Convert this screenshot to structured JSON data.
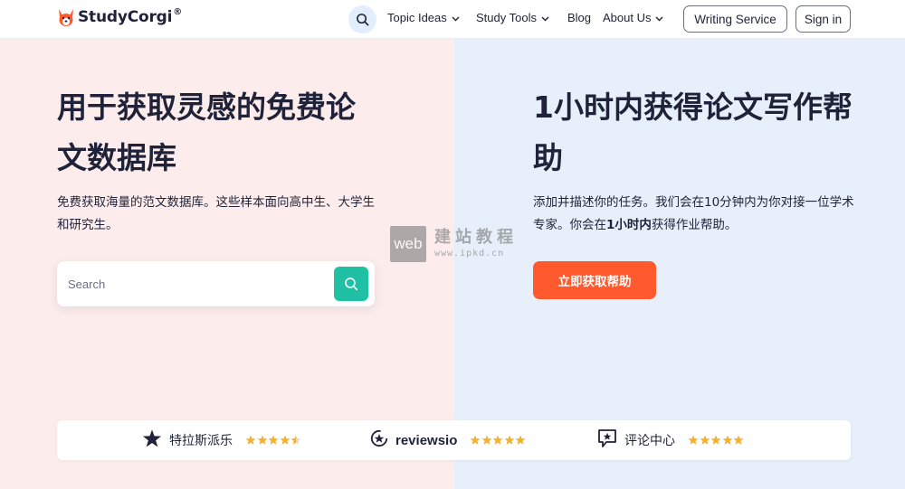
{
  "header": {
    "logo_text": "StudyCorgi",
    "logo_reg": "®",
    "nav": [
      {
        "label": "Topic Ideas",
        "has_dropdown": true
      },
      {
        "label": "Study Tools",
        "has_dropdown": true
      },
      {
        "label": "Blog",
        "has_dropdown": false
      },
      {
        "label": "About Us",
        "has_dropdown": true
      }
    ],
    "writing_service_label": "Writing Service",
    "sign_in_label": "Sign in"
  },
  "left": {
    "title_line1": "用于获取灵感的免费论",
    "title_line2": "文数据库",
    "desc_line1": "免费获取海量的范文数据库。这些样本面向高中生、大学生",
    "desc_line2": "和研究生。",
    "search_placeholder": "Search"
  },
  "right": {
    "title_prefix": "1",
    "title_line1_rest": "小时内获得论文写作帮",
    "title_line2": "助",
    "desc_line1": "添加并描述你的任务。我们会在10分钟内为你对接一位学术",
    "desc_line2_a": "专家。你会在",
    "desc_line2_bold": "1小时内",
    "desc_line2_b": "获得作业帮助。",
    "cta_label": "立即获取帮助"
  },
  "watermark": {
    "box_text": "web",
    "cn": "建站教程",
    "url": "www.ipkd.cn"
  },
  "reviews": [
    {
      "name": "特拉斯派乐",
      "icon": "trustpilot-star-icon",
      "rating": 4.5
    },
    {
      "name": "reviewsio",
      "icon": "reviewsio-icon",
      "rating": 5
    },
    {
      "name": "评论中心",
      "icon": "review-centre-icon",
      "rating": 5
    }
  ],
  "colors": {
    "left_bg": "#fcedec",
    "right_bg": "#e6effa",
    "accent_teal": "#1fc0a4",
    "cta_orange": "#ff5a2e",
    "star_gold": "#f3b12c"
  }
}
